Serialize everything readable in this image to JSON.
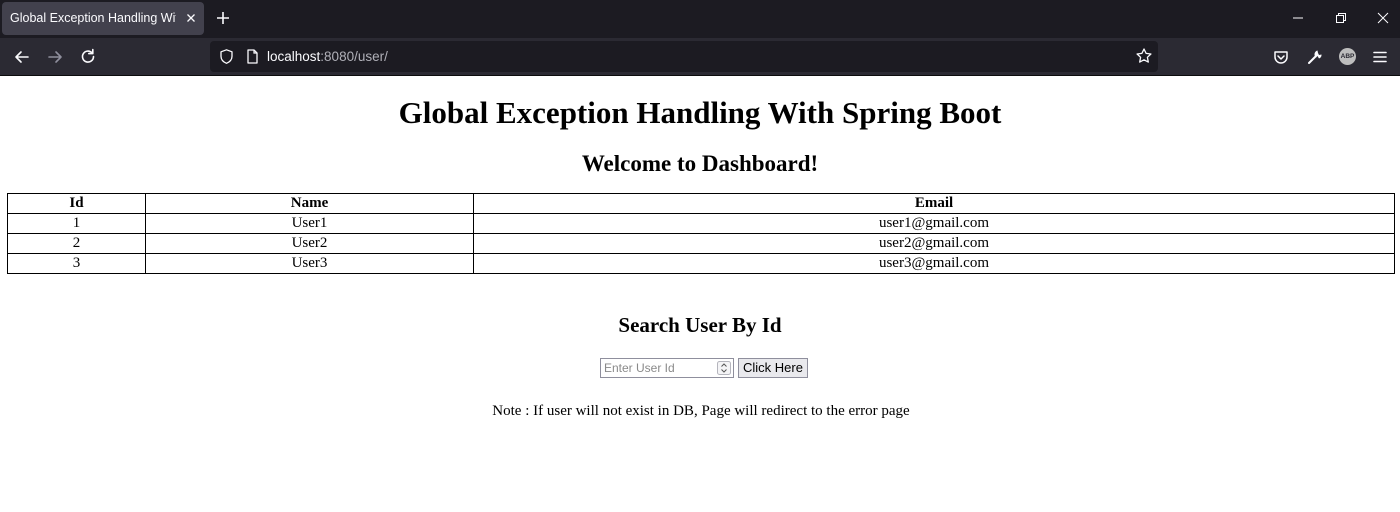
{
  "browser": {
    "tab_title": "Global Exception Handling With Sp",
    "url_host": "localhost",
    "url_rest": ":8080/user/",
    "extension_badge": "ABP"
  },
  "page": {
    "title": "Global Exception Handling With Spring Boot",
    "subtitle": "Welcome to Dashboard!",
    "table": {
      "headers": [
        "Id",
        "Name",
        "Email"
      ],
      "rows": [
        [
          "1",
          "User1",
          "user1@gmail.com"
        ],
        [
          "2",
          "User2",
          "user2@gmail.com"
        ],
        [
          "3",
          "User3",
          "user3@gmail.com"
        ]
      ]
    },
    "search": {
      "heading": "Search User By Id",
      "placeholder": "Enter User Id",
      "button_label": "Click Here"
    },
    "note": "Note : If user will not exist in DB, Page will redirect to the error page"
  },
  "icons": {
    "tab_close": "close-icon",
    "new_tab": "plus-icon",
    "minimize": "minimize-icon",
    "restore": "restore-icon",
    "close_window": "close-window-icon",
    "back": "arrow-left-icon",
    "forward": "arrow-right-icon",
    "reload": "reload-icon",
    "shield": "shield-icon",
    "page": "page-icon",
    "bookmark": "star-icon",
    "pocket": "pocket-icon",
    "tools": "wrench-icon",
    "menu": "hamburger-icon"
  }
}
